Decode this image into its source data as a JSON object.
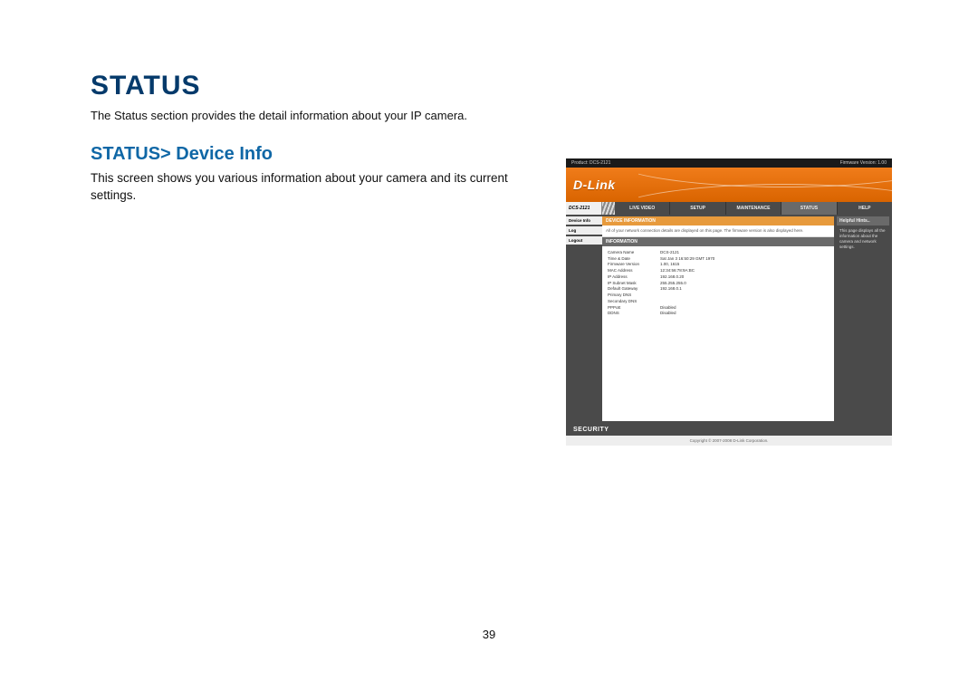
{
  "doc": {
    "heading1": "STATUS",
    "intro": "The Status section provides the detail information about your IP camera.",
    "heading2": "STATUS> Device Info",
    "desc": "This screen shows you various information about your camera and its current settings.",
    "page_num": "39"
  },
  "shot": {
    "topbar_left": "Product: DCS-2121",
    "topbar_right": "Firmware Version: 1.00",
    "brand": "D-Link",
    "model_tab": "DCS-2121",
    "tabs": [
      "LIVE VIDEO",
      "SETUP",
      "MAINTENANCE",
      "STATUS",
      "HELP"
    ],
    "active_tab_index": 3,
    "sidebar": [
      "Device Info",
      "Log",
      "Logout"
    ],
    "content": {
      "section_head": "DEVICE INFORMATION",
      "section_desc": "All of your network connection details are displayed on this page. The firmware version is also displayed here.",
      "info_head": "INFORMATION",
      "rows": [
        {
          "label": "Camera Name",
          "value": "DCS-2121"
        },
        {
          "label": "Time & Date",
          "value": "Sat Jan 3 16:50:29 GMT 1970"
        },
        {
          "label": "Firmware Version",
          "value": "1.00, 1615"
        },
        {
          "label": "MAC Address",
          "value": "12:34:56:78:9A:BC"
        },
        {
          "label": "IP Address",
          "value": "192.168.0.20"
        },
        {
          "label": "IP Subnet Mask",
          "value": "255.255.255.0"
        },
        {
          "label": "Default Gateway",
          "value": "192.168.0.1"
        },
        {
          "label": "Primary DNS",
          "value": ""
        },
        {
          "label": "Secondary DNS",
          "value": ""
        },
        {
          "label": "PPPoE",
          "value": "Disabled"
        },
        {
          "label": "DDNS",
          "value": "Disabled"
        }
      ]
    },
    "hints_head": "Helpful Hints..",
    "hints_body": "This page displays all the information about the camera and network settings.",
    "footer": "SECURITY",
    "copyright": "Copyright © 2007-2008 D-Link Corporation."
  }
}
